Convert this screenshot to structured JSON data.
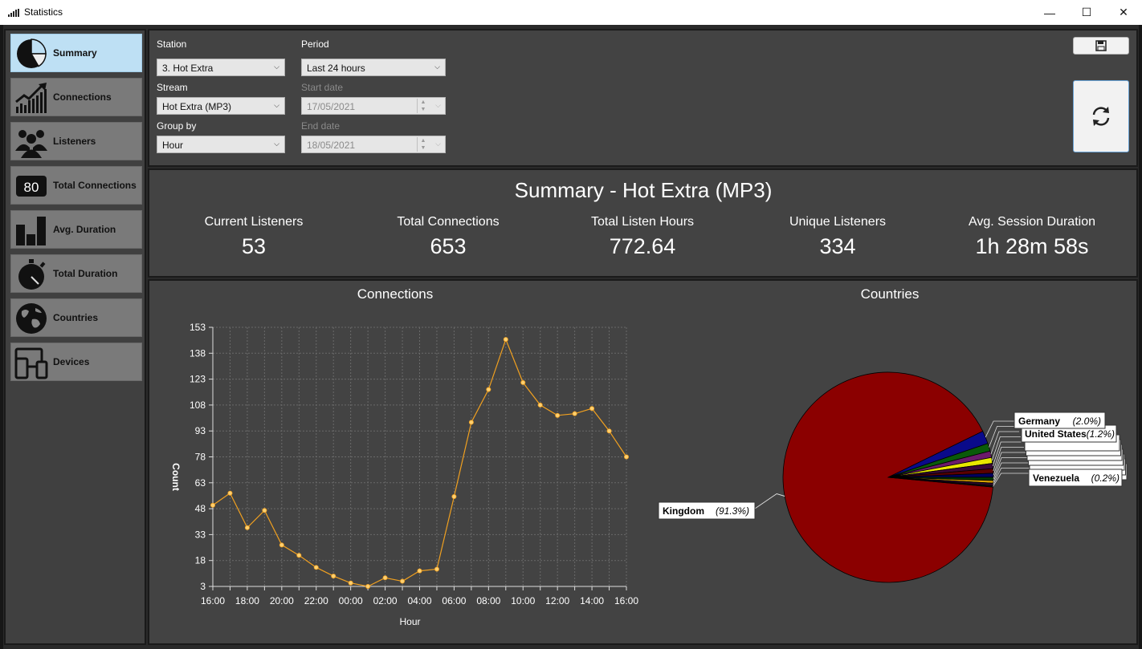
{
  "window": {
    "title": "Statistics",
    "minimize": "—",
    "maximize": "☐",
    "close": "✕"
  },
  "sidebar": {
    "items": [
      {
        "label": "Summary",
        "icon": "pie-chart-icon",
        "active": true
      },
      {
        "label": "Connections",
        "icon": "trend-up-icon",
        "active": false
      },
      {
        "label": "Listeners",
        "icon": "people-icon",
        "active": false
      },
      {
        "label": "Total Connections",
        "icon": "counter-icon",
        "active": false
      },
      {
        "label": "Avg. Duration",
        "icon": "bar-chart-icon",
        "active": false
      },
      {
        "label": "Total Duration",
        "icon": "stopwatch-icon",
        "active": false
      },
      {
        "label": "Countries",
        "icon": "globe-icon",
        "active": false
      },
      {
        "label": "Devices",
        "icon": "devices-icon",
        "active": false
      }
    ],
    "counter_text": "80"
  },
  "filters": {
    "station_label": "Station",
    "station_value": "3. Hot Extra",
    "stream_label": "Stream",
    "stream_value": "Hot Extra (MP3)",
    "groupby_label": "Group by",
    "groupby_value": "Hour",
    "period_label": "Period",
    "period_value": "Last 24 hours",
    "start_label": "Start date",
    "start_value": "17/05/2021",
    "end_label": "End date",
    "end_value": "18/05/2021"
  },
  "summary": {
    "title": "Summary - Hot Extra (MP3)",
    "stats": [
      {
        "label": "Current Listeners",
        "value": "53"
      },
      {
        "label": "Total Connections",
        "value": "653"
      },
      {
        "label": "Total Listen Hours",
        "value": "772.64"
      },
      {
        "label": "Unique Listeners",
        "value": "334"
      },
      {
        "label": "Avg. Session Duration",
        "value": "1h 28m 58s"
      }
    ]
  },
  "chart_data": [
    {
      "type": "line",
      "title": "Connections",
      "xlabel": "Hour",
      "ylabel": "Count",
      "ylim": [
        3,
        153
      ],
      "y_ticks": [
        3,
        18,
        33,
        48,
        63,
        78,
        93,
        108,
        123,
        138,
        153
      ],
      "x_tick_labels": [
        "16:00",
        "18:00",
        "20:00",
        "22:00",
        "00:00",
        "02:00",
        "04:00",
        "06:00",
        "08:00",
        "10:00",
        "12:00",
        "14:00",
        "16:00"
      ],
      "x": [
        "16:00",
        "17:00",
        "18:00",
        "19:00",
        "20:00",
        "21:00",
        "22:00",
        "23:00",
        "00:00",
        "01:00",
        "02:00",
        "03:00",
        "04:00",
        "05:00",
        "06:00",
        "07:00",
        "08:00",
        "09:00",
        "10:00",
        "11:00",
        "12:00",
        "13:00",
        "14:00",
        "15:00",
        "16:00"
      ],
      "values": [
        50,
        57,
        37,
        47,
        27,
        21,
        14,
        9,
        5,
        3,
        8,
        6,
        12,
        13,
        55,
        98,
        117,
        146,
        121,
        108,
        102,
        103,
        106,
        93,
        78
      ],
      "color": "#f0a020",
      "grid": true
    },
    {
      "type": "pie",
      "title": "Countries",
      "slices": [
        {
          "label": "Kingdom",
          "value": 91.3,
          "label_text": "(91.3%)",
          "color": "#8b0000"
        },
        {
          "label": "Germany",
          "value": 2.0,
          "label_text": "(2.0%)",
          "color": "#0a0a8a"
        },
        {
          "label": "United States",
          "value": 1.2,
          "label_text": "(1.2%)",
          "color": "#0a5a0a"
        },
        {
          "label": "",
          "value": 1.0,
          "label_text": "",
          "color": "#6b1a6b"
        },
        {
          "label": "",
          "value": 0.9,
          "label_text": "",
          "color": "#e8e800"
        },
        {
          "label": "",
          "value": 0.8,
          "label_text": "",
          "color": "#3a0a3a"
        },
        {
          "label": "",
          "value": 0.7,
          "label_text": "",
          "color": "#5a0000"
        },
        {
          "label": "",
          "value": 0.6,
          "label_text": "",
          "color": "#000060"
        },
        {
          "label": "",
          "value": 0.5,
          "label_text": "",
          "color": "#003a00"
        },
        {
          "label": "",
          "value": 0.4,
          "label_text": "",
          "color": "#d8a000"
        },
        {
          "label": "",
          "value": 0.4,
          "label_text": "",
          "color": "#2a0a2a"
        },
        {
          "label": "Venezuela",
          "value": 0.2,
          "label_text": "(0.2%)",
          "color": "#111111"
        }
      ]
    }
  ]
}
